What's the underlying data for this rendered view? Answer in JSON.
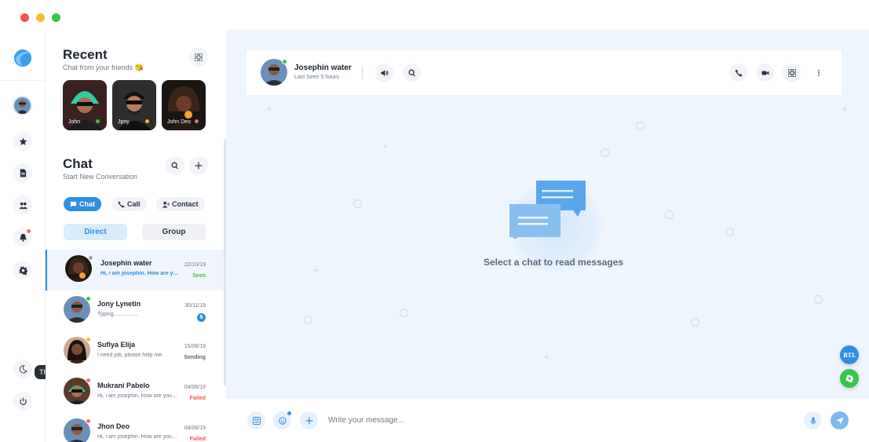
{
  "window": {
    "controls": [
      "close",
      "minimize",
      "maximize"
    ]
  },
  "colors": {
    "accent": "#2f8fe0",
    "online": "#36c648",
    "away": "#f6bc31",
    "danger": "#f36b6b",
    "seen": "#36c648",
    "failed": "#f2544b",
    "sending": "#6d7685"
  },
  "rail": {
    "items": [
      "star-icon",
      "file-icon",
      "users-icon",
      "bell-icon",
      "gear-icon"
    ],
    "bottom": [
      "moon-icon",
      "power-icon"
    ],
    "tooltip": "Theme Mode"
  },
  "recent": {
    "title": "Recent",
    "subtitle": "Chat from your friends 😘",
    "stories": [
      {
        "name": "John",
        "status": "online"
      },
      {
        "name": "Jpny",
        "status": "away"
      },
      {
        "name": "John Deo",
        "status": "busy"
      }
    ]
  },
  "chat": {
    "title": "Chat",
    "subtitle": "Start New Conversation",
    "tabs": [
      {
        "label": "Chat",
        "active": true
      },
      {
        "label": "Call",
        "active": false
      },
      {
        "label": "Contact",
        "active": false
      }
    ],
    "segments": [
      {
        "label": "Direct",
        "active": true
      },
      {
        "label": "Group",
        "active": false
      }
    ],
    "conversations": [
      {
        "name": "Josephin water",
        "message": "Hi, i am josephin. How are you.. ! There are many variations of passages.",
        "date": "22/10/19",
        "status": "Seen",
        "active": true
      },
      {
        "name": "Jony Lynetin",
        "message": "Typing................",
        "date": "30/11/19",
        "unread": "8"
      },
      {
        "name": "Sufiya Elija",
        "message": "I need job, please help me.",
        "date": "15/06/19",
        "status": "Sending"
      },
      {
        "name": "Mukrani Pabelo",
        "message": "Hi, i am josephin. How are you.. ! There are many variations of passages.",
        "date": "04/06/19",
        "status": "Failed"
      },
      {
        "name": "Jhon Deo",
        "message": "Hi, i am josephin. How are you.. ! There are many variations of passages.",
        "date": "04/06/19",
        "status": "Failed"
      }
    ]
  },
  "header": {
    "name": "Josephin water",
    "last_seen": "Last Seen 5 hours"
  },
  "empty_state": {
    "text": "Select a chat to read messages"
  },
  "fabs": {
    "rtl_label": "RTL"
  },
  "composer": {
    "placeholder": "Write your message..."
  }
}
